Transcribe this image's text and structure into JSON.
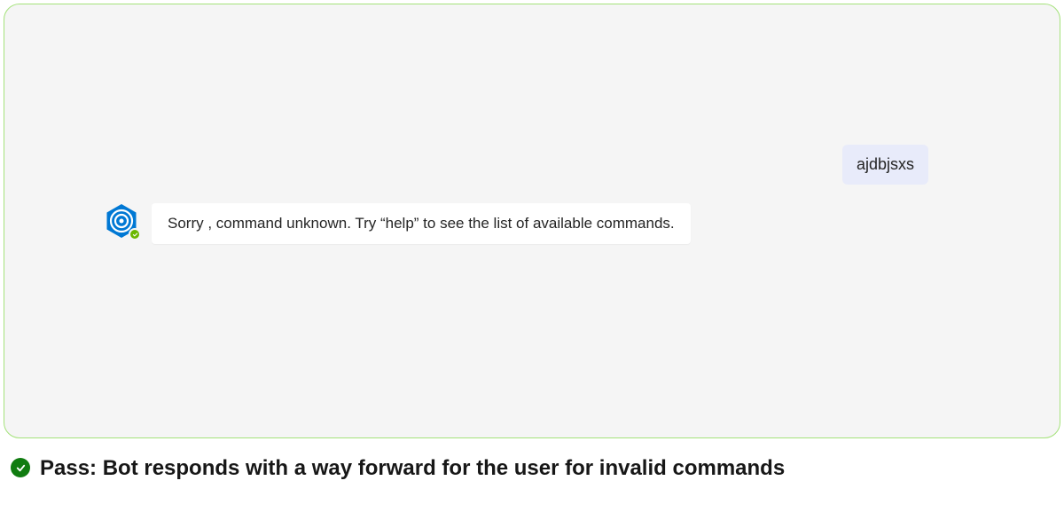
{
  "chat": {
    "user_message": "ajdbjsxs",
    "bot_message": "Sorry , command unknown. Try “help” to see the list of available commands."
  },
  "caption": {
    "text": "Pass: Bot responds with a way forward for the user for invalid commands"
  },
  "colors": {
    "panel_border": "#a4e27a",
    "panel_bg": "#f5f5f5",
    "user_bubble_bg": "#e8ebfa",
    "bot_bubble_bg": "#ffffff",
    "bot_hex": "#0078d4",
    "presence": "#6bb700",
    "pass_check": "#107c10"
  }
}
